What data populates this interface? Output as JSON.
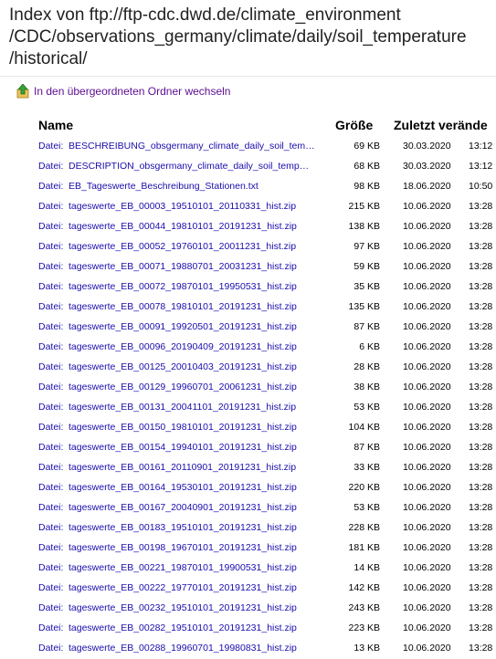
{
  "title_lines": [
    "Index von ftp://ftp-cdc.dwd.de/climate_environment",
    "/CDC/observations_germany/climate/daily/soil_temperature",
    "/historical/"
  ],
  "up_link": {
    "label": "In den übergeordneten Ordner wechseln",
    "icon": "up-folder-icon"
  },
  "columns": {
    "name": "Name",
    "size": "Größe",
    "modified": "Zuletzt verände"
  },
  "file_prefix": "Datei:",
  "files": [
    {
      "name": "BESCHREIBUNG_obsgermany_climate_daily_soil_tem…",
      "size": "69 KB",
      "date": "30.03.2020",
      "time": "13:12"
    },
    {
      "name": "DESCRIPTION_obsgermany_climate_daily_soil_temp…",
      "size": "68 KB",
      "date": "30.03.2020",
      "time": "13:12"
    },
    {
      "name": "EB_Tageswerte_Beschreibung_Stationen.txt",
      "size": "98 KB",
      "date": "18.06.2020",
      "time": "10:50"
    },
    {
      "name": "tageswerte_EB_00003_19510101_20110331_hist.zip",
      "size": "215 KB",
      "date": "10.06.2020",
      "time": "13:28"
    },
    {
      "name": "tageswerte_EB_00044_19810101_20191231_hist.zip",
      "size": "138 KB",
      "date": "10.06.2020",
      "time": "13:28"
    },
    {
      "name": "tageswerte_EB_00052_19760101_20011231_hist.zip",
      "size": "97 KB",
      "date": "10.06.2020",
      "time": "13:28"
    },
    {
      "name": "tageswerte_EB_00071_19880701_20031231_hist.zip",
      "size": "59 KB",
      "date": "10.06.2020",
      "time": "13:28"
    },
    {
      "name": "tageswerte_EB_00072_19870101_19950531_hist.zip",
      "size": "35 KB",
      "date": "10.06.2020",
      "time": "13:28"
    },
    {
      "name": "tageswerte_EB_00078_19810101_20191231_hist.zip",
      "size": "135 KB",
      "date": "10.06.2020",
      "time": "13:28"
    },
    {
      "name": "tageswerte_EB_00091_19920501_20191231_hist.zip",
      "size": "87 KB",
      "date": "10.06.2020",
      "time": "13:28"
    },
    {
      "name": "tageswerte_EB_00096_20190409_20191231_hist.zip",
      "size": "6 KB",
      "date": "10.06.2020",
      "time": "13:28"
    },
    {
      "name": "tageswerte_EB_00125_20010403_20191231_hist.zip",
      "size": "28 KB",
      "date": "10.06.2020",
      "time": "13:28"
    },
    {
      "name": "tageswerte_EB_00129_19960701_20061231_hist.zip",
      "size": "38 KB",
      "date": "10.06.2020",
      "time": "13:28"
    },
    {
      "name": "tageswerte_EB_00131_20041101_20191231_hist.zip",
      "size": "53 KB",
      "date": "10.06.2020",
      "time": "13:28"
    },
    {
      "name": "tageswerte_EB_00150_19810101_20191231_hist.zip",
      "size": "104 KB",
      "date": "10.06.2020",
      "time": "13:28"
    },
    {
      "name": "tageswerte_EB_00154_19940101_20191231_hist.zip",
      "size": "87 KB",
      "date": "10.06.2020",
      "time": "13:28"
    },
    {
      "name": "tageswerte_EB_00161_20110901_20191231_hist.zip",
      "size": "33 KB",
      "date": "10.06.2020",
      "time": "13:28"
    },
    {
      "name": "tageswerte_EB_00164_19530101_20191231_hist.zip",
      "size": "220 KB",
      "date": "10.06.2020",
      "time": "13:28"
    },
    {
      "name": "tageswerte_EB_00167_20040901_20191231_hist.zip",
      "size": "53 KB",
      "date": "10.06.2020",
      "time": "13:28"
    },
    {
      "name": "tageswerte_EB_00183_19510101_20191231_hist.zip",
      "size": "228 KB",
      "date": "10.06.2020",
      "time": "13:28"
    },
    {
      "name": "tageswerte_EB_00198_19670101_20191231_hist.zip",
      "size": "181 KB",
      "date": "10.06.2020",
      "time": "13:28"
    },
    {
      "name": "tageswerte_EB_00221_19870101_19900531_hist.zip",
      "size": "14 KB",
      "date": "10.06.2020",
      "time": "13:28"
    },
    {
      "name": "tageswerte_EB_00222_19770101_20191231_hist.zip",
      "size": "142 KB",
      "date": "10.06.2020",
      "time": "13:28"
    },
    {
      "name": "tageswerte_EB_00232_19510101_20191231_hist.zip",
      "size": "243 KB",
      "date": "10.06.2020",
      "time": "13:28"
    },
    {
      "name": "tageswerte_EB_00282_19510101_20191231_hist.zip",
      "size": "223 KB",
      "date": "10.06.2020",
      "time": "13:28"
    },
    {
      "name": "tageswerte_EB_00288_19960701_19980831_hist.zip",
      "size": "13 KB",
      "date": "10.06.2020",
      "time": "13:28"
    }
  ]
}
